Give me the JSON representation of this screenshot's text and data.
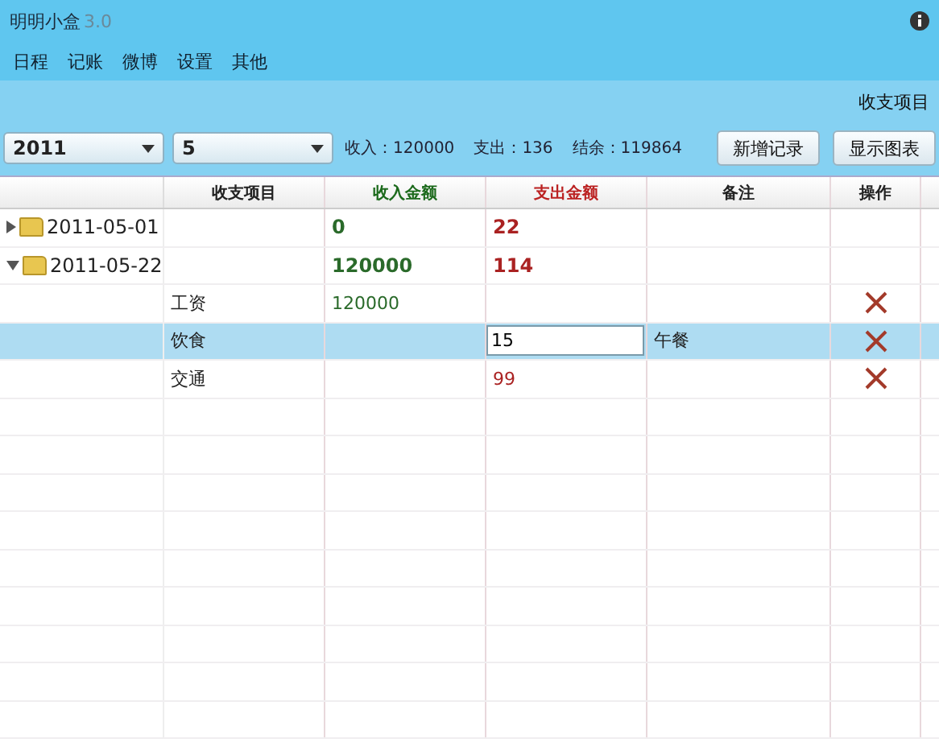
{
  "window": {
    "title": "明明小盒",
    "version": "3.0"
  },
  "menu": [
    "日程",
    "记账",
    "微博",
    "设置",
    "其他"
  ],
  "view_tab": "收支项目",
  "filters": {
    "year": "2011",
    "month": "5"
  },
  "summary": [
    "收入：120000",
    "支出：136",
    "结余：119864"
  ],
  "buttons": [
    "新增记录",
    "显示图表"
  ],
  "table": {
    "columns": [
      "收支项目",
      "收入金额",
      "支出金额",
      "备注",
      "操作"
    ],
    "rows": [
      {
        "date": "2011-05-01",
        "expanded": false,
        "income": "0",
        "expense": "22"
      },
      {
        "date": "2011-05-22",
        "expanded": true,
        "income": "120000",
        "expense": "114",
        "children": [
          {
            "item": "工资",
            "income": "120000",
            "selected": false,
            "editing": false
          },
          {
            "item": "饮食",
            "expense": "15",
            "note": "午餐",
            "selected": true,
            "editing": true
          },
          {
            "item": "交通",
            "expense": "99",
            "selected": false,
            "editing": false
          }
        ]
      }
    ]
  }
}
